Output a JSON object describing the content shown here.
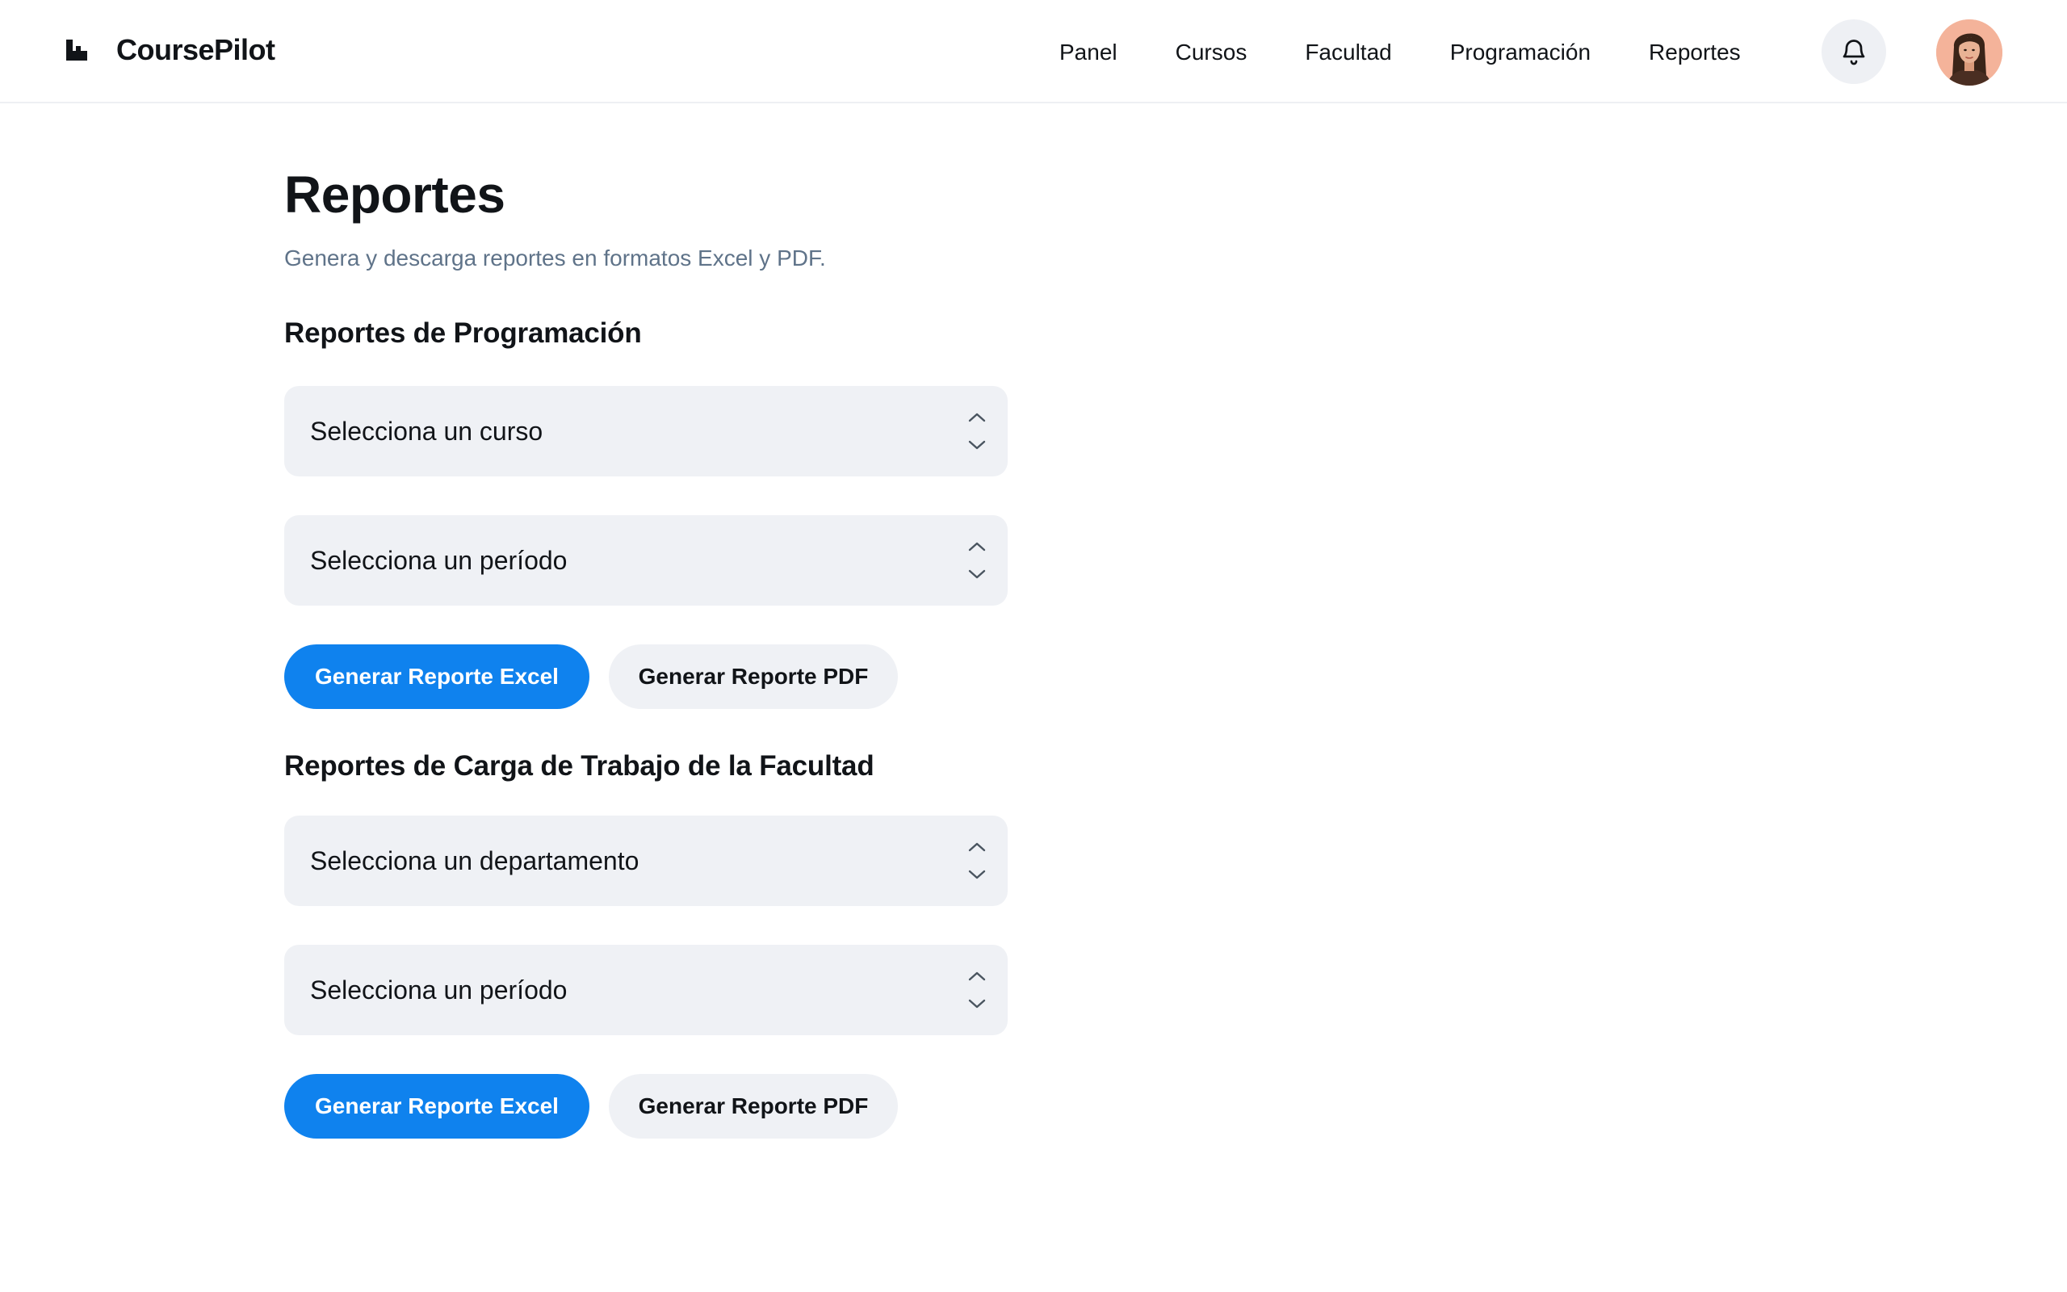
{
  "app": {
    "brand_name": "CoursePilot"
  },
  "nav": {
    "items": [
      {
        "label": "Panel"
      },
      {
        "label": "Cursos"
      },
      {
        "label": "Facultad"
      },
      {
        "label": "Programación"
      },
      {
        "label": "Reportes"
      }
    ],
    "notifications_icon": "bell-icon",
    "avatar_icon": "user-avatar"
  },
  "page": {
    "title": "Reportes",
    "subtitle": "Genera y descarga reportes en formatos Excel y PDF."
  },
  "sections": [
    {
      "title": "Reportes de Programación",
      "selects": [
        {
          "value": "Selecciona un curso"
        },
        {
          "value": "Selecciona un período"
        }
      ],
      "excel_label": "Generar Reporte Excel",
      "pdf_label": "Generar Reporte PDF"
    },
    {
      "title": "Reportes de Carga de Trabajo de la Facultad",
      "selects": [
        {
          "value": "Selecciona un departamento"
        },
        {
          "value": "Selecciona un período"
        }
      ],
      "excel_label": "Generar Reporte Excel",
      "pdf_label": "Generar Reporte PDF"
    }
  ],
  "colors": {
    "primary": "#0f82ee",
    "input_bg": "#eff1f5",
    "subtitle": "#5f7389",
    "text": "#111418"
  }
}
